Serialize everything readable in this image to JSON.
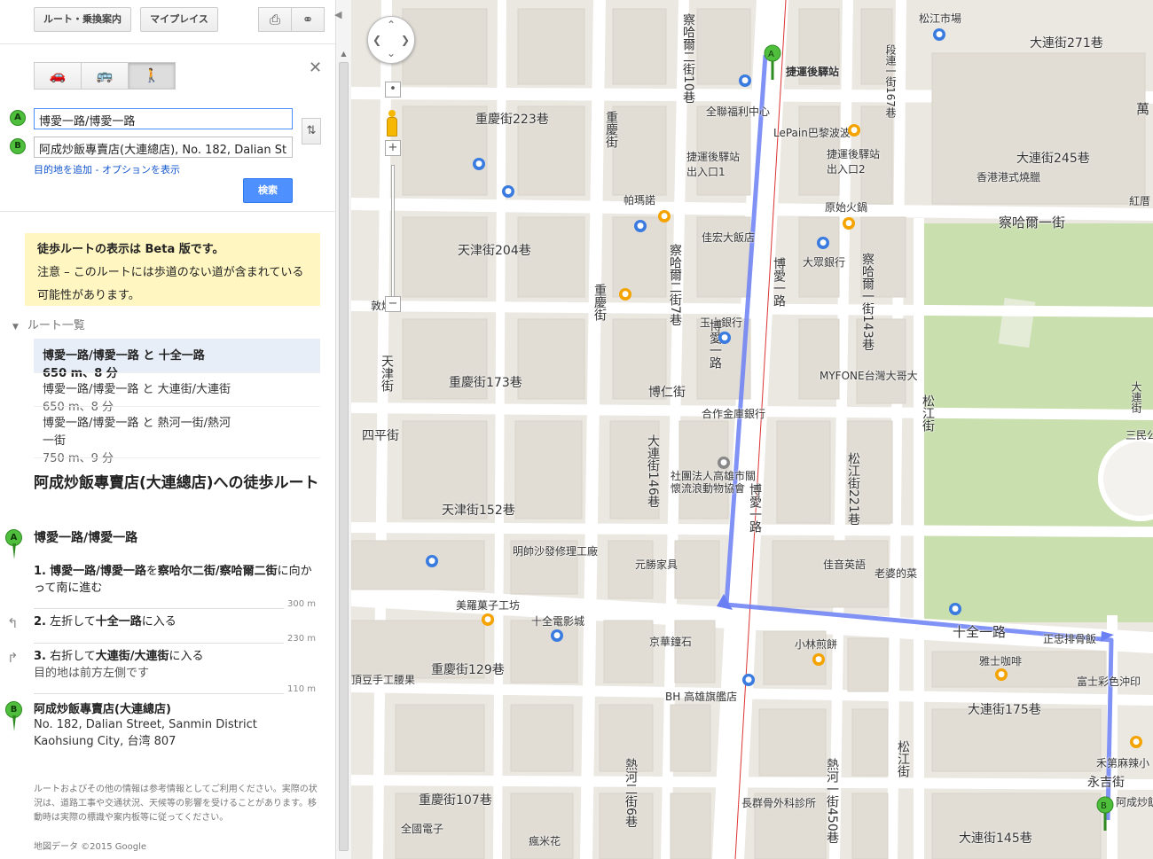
{
  "topbar": {
    "route_button": "ルート・乗換案内",
    "myplaces_button": "マイプレイス",
    "print_icon": "print-icon",
    "link_icon": "link-icon"
  },
  "modes": [
    {
      "name": "car-icon",
      "glyph": "🚗",
      "selected": false
    },
    {
      "name": "transit-icon",
      "glyph": "🚌",
      "selected": false
    },
    {
      "name": "walk-icon",
      "glyph": "🚶",
      "selected": true
    }
  ],
  "form": {
    "marker_a": "A",
    "marker_b": "B",
    "start_value": "博愛一路/博愛一路",
    "end_value": "阿成炒飯專賣店(大連總店), No. 182, Dalian St",
    "add_destination": "目的地を追加",
    "separator": " - ",
    "show_options": "オプションを表示",
    "search_button": "検索"
  },
  "beta": {
    "title": "徒歩ルートの表示は Beta 版です。",
    "body": "注意 – このルートには歩道のない道が含まれている可能性があります。"
  },
  "routes": {
    "heading": "ルート一覧",
    "items": [
      {
        "name": "博愛一路/博愛一路 と 十全一路",
        "meta": "650 m、8 分",
        "selected": true
      },
      {
        "name": "博愛一路/博愛一路 と 大連街/大連街",
        "meta": "650 m、8 分",
        "selected": false
      },
      {
        "name": "博愛一路/博愛一路 と 熱河一街/熱河一街",
        "meta": "750 m、9 分",
        "selected": false
      }
    ]
  },
  "directions": {
    "title": "阿成炒飯專賣店(大連總店)への徒歩ルート",
    "start_name": "博愛一路/博愛一路",
    "steps": [
      {
        "num": "1.",
        "text_bold": "博愛一路/博愛一路",
        "text_mid": "を",
        "text_bold2": "察哈尔二街/察哈爾二街",
        "text_end": "に向かって南に進む",
        "sub": "",
        "distance": "300 m"
      },
      {
        "num": "2.",
        "text_bold": "",
        "text_mid": "左折して",
        "text_bold2": "十全一路",
        "text_end": "に入る",
        "sub": "",
        "distance": "230 m"
      },
      {
        "num": "3.",
        "text_bold": "",
        "text_mid": "右折して",
        "text_bold2": "大連街/大連街",
        "text_end": "に入る",
        "sub": "目的地は前方左側です",
        "distance": "110 m"
      }
    ],
    "end_name": "阿成炒飯專賣店(大連總店)",
    "address_line1": "No. 182, Dalian Street, Sanmin District",
    "address_line2": "Kaohsiung City, 台湾 807"
  },
  "footer": {
    "disclaimer": "ルートおよびその他の情報は参考情報としてご利用ください。実際の状況は、道路工事や交通状況、天候等の影響を受けることがあります。移動時は実際の標識や案内板等に従ってください。",
    "credit": "地図データ ©2015 Google"
  },
  "map": {
    "route_color": "#6b7ff5",
    "labels": [
      "松江市場",
      "大連街271巷",
      "捷運後驛站",
      "重慶街223巷",
      "全聯福利中心",
      "LePain巴黎波波",
      "捷運後驛站出入口1",
      "捷運後驛站出入口2",
      "大連街245巷",
      "香港港式燒臘",
      "察哈爾一街",
      "帕瑪諾",
      "原始火鍋",
      "天津街204巷",
      "佳宏大飯店",
      "大眾銀行",
      "玉山銀行",
      "MYFONE台灣大哥大",
      "重慶街173巷",
      "博仁街",
      "合作金庫銀行",
      "四平街",
      "社團法人高雄市關懷流浪動物協會",
      "天津街152巷",
      "明帥沙發修理工廠",
      "元勝家具",
      "佳音英語",
      "老婆的菜",
      "美羅菓子工坊",
      "十全電影城",
      "京華鐘石",
      "小林煎餅",
      "十全一路",
      "正忠排骨飯",
      "雅士咖啡",
      "富士彩色沖印",
      "重慶街129巷",
      "BH 高雄旗艦店",
      "大連街175巷",
      "永吉街",
      "長群骨外科診所",
      "重慶街107巷",
      "全國電子",
      "瘋米花",
      "大連街145巷",
      "敦煌",
      "天津街",
      "博愛一路",
      "察哈爾二街10巷",
      "察哈爾二街7巷",
      "大連街146巷",
      "松江街221巷",
      "熱河一街450巷",
      "熱河二街6巷",
      "松江街",
      "重慶街",
      "段連一街167巷",
      "察哈爾一街143巷",
      "大連街",
      "三民公園",
      "頂豆手工腰果",
      "禾第麻辣小",
      "阿成炒飯",
      "萬",
      "紅厝"
    ]
  }
}
